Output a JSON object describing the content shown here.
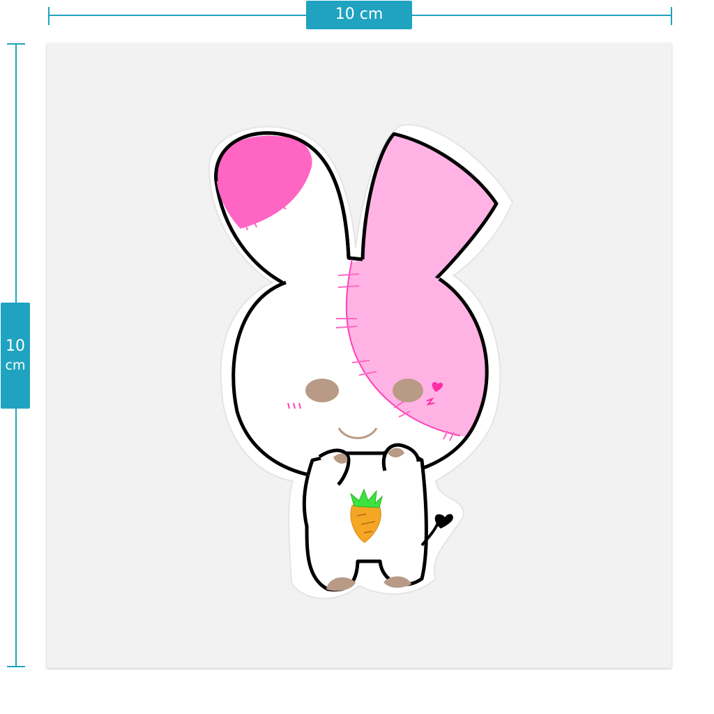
{
  "dimensions": {
    "width_label": "10 cm",
    "height_value": "10",
    "height_unit": "cm"
  },
  "colors": {
    "accent": "#1fa3c0",
    "sheet": "#f2f2f2",
    "ear_pink_dark": "#ff66c4",
    "ear_pink_light": "#ffb3e4",
    "eye_brown": "#b89a86",
    "carrot_orange": "#f5a623",
    "carrot_leaves": "#3ee23e"
  },
  "sticker": {
    "subject": "bunny-sticker"
  }
}
